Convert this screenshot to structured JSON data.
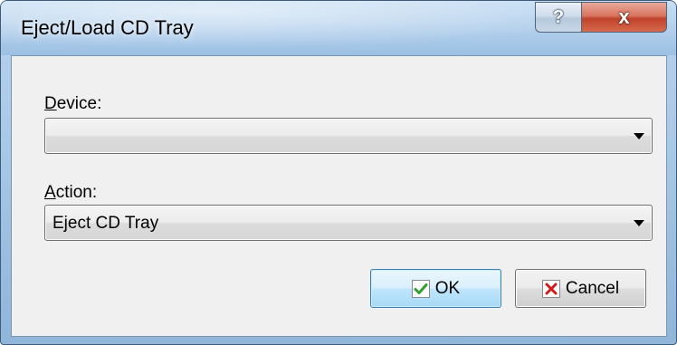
{
  "window": {
    "title": "Eject/Load CD Tray",
    "help_glyph": "?",
    "close_glyph": "x"
  },
  "form": {
    "device": {
      "label_accel": "D",
      "label_rest": "evice:",
      "value": ""
    },
    "action": {
      "label_accel": "A",
      "label_rest": "ction:",
      "value": "Eject CD Tray"
    }
  },
  "buttons": {
    "ok": {
      "label": "OK",
      "icon": "checkmark-icon",
      "icon_color": "#2f9e2f"
    },
    "cancel": {
      "label": "Cancel",
      "icon": "x-mark-icon",
      "icon_color": "#d11c1c"
    }
  }
}
